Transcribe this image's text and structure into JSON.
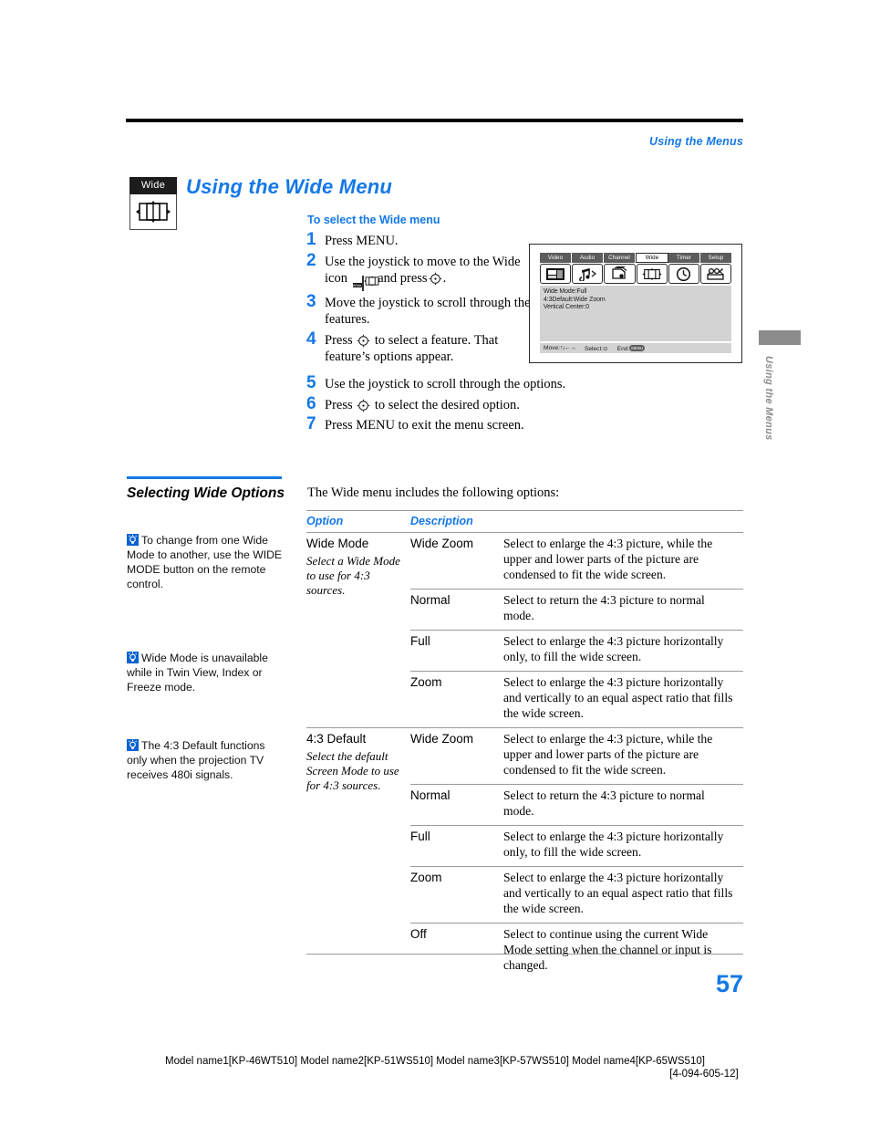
{
  "running_head": "Using the Menus",
  "marker": {
    "label": "Wide",
    "icon": "wide-screen-icon"
  },
  "page_title": "Using the Wide Menu",
  "procedure": {
    "heading": "To select the Wide menu",
    "steps": [
      {
        "num": "1",
        "text": "Press MENU."
      },
      {
        "num": "2",
        "text_before": "Use the joystick to move to the Wide icon",
        "text_mid": "and press",
        "text_after": "."
      },
      {
        "num": "3",
        "text": "Move the joystick to scroll through the features."
      },
      {
        "num": "4",
        "text_before": "Press",
        "text_after": "to select a feature. That feature’s options appear."
      },
      {
        "num": "5",
        "text": "Use the joystick to scroll through the options."
      },
      {
        "num": "6",
        "text_before": "Press",
        "text_after": "to select the desired option."
      },
      {
        "num": "7",
        "text": "Press MENU to exit the menu screen."
      }
    ]
  },
  "osd": {
    "tabs": [
      {
        "label": "Video",
        "selected": false,
        "icon": "video-icon"
      },
      {
        "label": "Audio",
        "selected": false,
        "icon": "audio-note-icon"
      },
      {
        "label": "Channel",
        "selected": false,
        "icon": "channel-cards-icon"
      },
      {
        "label": "Wide",
        "selected": true,
        "icon": "wide-screen-icon"
      },
      {
        "label": "Timer",
        "selected": false,
        "icon": "clock-icon"
      },
      {
        "label": "Setup",
        "selected": false,
        "icon": "setup-tools-icon"
      }
    ],
    "settings": [
      "Wide  Mode:Full",
      "4:3Default:Wide Zoom",
      "Vertical  Center:0"
    ],
    "footer": {
      "move_label": "Move:",
      "move_arrows": "↑↓←→",
      "select_label": "Select:",
      "select_symbol": "⊙",
      "end_label": "End:",
      "end_symbol": "MENU"
    }
  },
  "thumb_tab": {
    "text": "Using the Menus"
  },
  "section": {
    "heading": "Selecting Wide Options",
    "notes": [
      "To change from one Wide Mode to another, use the WIDE MODE button on the remote control.",
      "Wide Mode is unavailable while in Twin View, Index or Freeze mode.",
      "The 4:3 Default functions only when the projection TV receives 480i signals."
    ]
  },
  "intro": "The Wide menu includes the following options:",
  "table": {
    "headers": {
      "option": "Option",
      "description": "Description"
    },
    "groups": [
      {
        "name": "Wide Mode",
        "sub": "Select a Wide Mode to use for 4:3 sources.",
        "rows": [
          {
            "value": "Wide Zoom",
            "desc": "Select to enlarge the 4:3 picture, while the upper and lower parts of the picture are condensed to fit the wide screen."
          },
          {
            "value": "Normal",
            "desc": "Select to return the 4:3 picture to normal mode."
          },
          {
            "value": "Full",
            "desc": "Select to enlarge the 4:3 picture horizontally only, to fill the wide screen."
          },
          {
            "value": "Zoom",
            "desc": "Select to enlarge the 4:3 picture horizontally and vertically to an equal aspect ratio that fills the wide screen."
          }
        ]
      },
      {
        "name": "4:3 Default",
        "sub": "Select the default Screen Mode to use for 4:3 sources.",
        "rows": [
          {
            "value": "Wide Zoom",
            "desc": "Select to enlarge the 4:3 picture, while the upper and lower parts of the picture are condensed to fit the wide screen."
          },
          {
            "value": "Normal",
            "desc": "Select to return the 4:3 picture to normal mode."
          },
          {
            "value": "Full",
            "desc": "Select to enlarge the 4:3 picture horizontally only, to fill the wide screen."
          },
          {
            "value": "Zoom",
            "desc": "Select to enlarge the 4:3 picture horizontally and vertically to an equal aspect ratio that fills the wide screen."
          },
          {
            "value": "Off",
            "desc": "Select to continue using the current Wide Mode setting when the channel or input is changed."
          }
        ]
      }
    ]
  },
  "page_number": "57",
  "footer": {
    "line1": "Model name1[KP-46WT510] Model name2[KP-51WS510] Model name3[KP-57WS510] Model name4[KP-65WS510]",
    "line2": "[4-094-605-12]"
  },
  "colors": {
    "accent": "#1478E6",
    "tip": "#0A62D0",
    "tab_gray": "#8c8c8c",
    "osd_gray": "#d3d3d3"
  }
}
